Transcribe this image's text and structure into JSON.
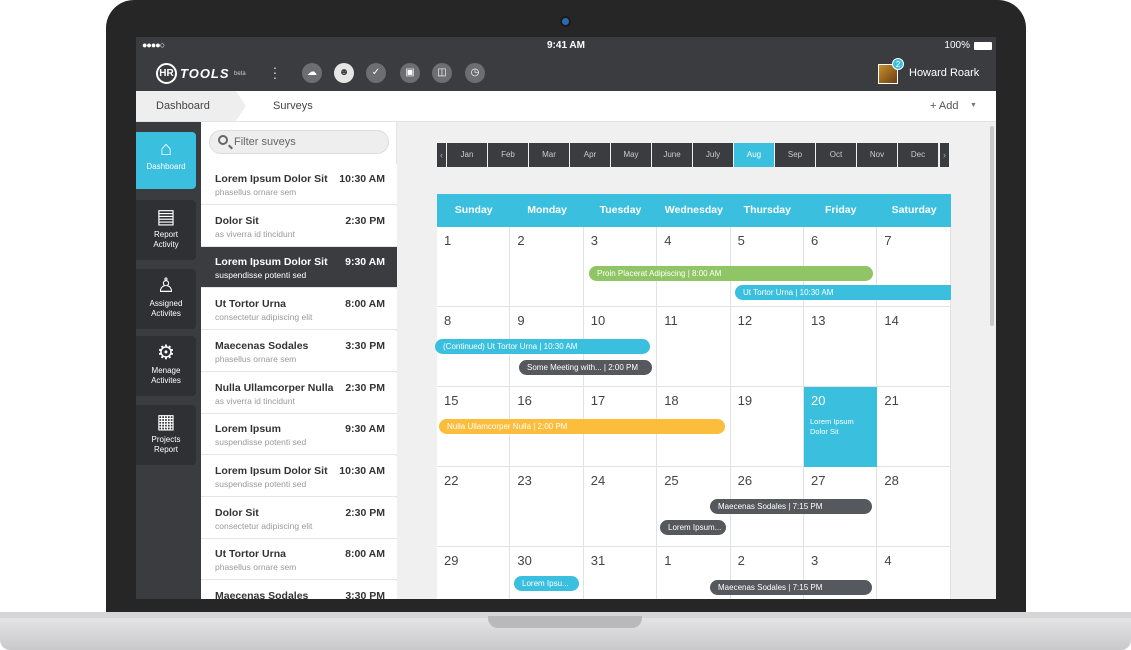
{
  "statusbar": {
    "signal": "●●●●○",
    "time": "9:41 AM",
    "battery": "100%"
  },
  "topbar": {
    "logo_text": "TOOLS",
    "logo_mark": "HR",
    "logo_suffix": "beta",
    "icons": [
      "chat-icon",
      "people-icon",
      "clipboard-icon",
      "book-icon",
      "briefcase-icon",
      "watch-icon"
    ],
    "user": {
      "name": "Howard Roark",
      "notifications": "2"
    }
  },
  "breadcrumb": {
    "first": "Dashboard",
    "second": "Surveys",
    "add_label": "+ Add"
  },
  "sidebar": {
    "items": [
      {
        "label": "Dashboard",
        "icon": "⌂"
      },
      {
        "label": "Report Activity",
        "icon": "▤"
      },
      {
        "label": "Assigned Activites",
        "icon": "♙"
      },
      {
        "label": "Menage Activites",
        "icon": "⚙"
      },
      {
        "label": "Projects Report",
        "icon": "▦"
      }
    ]
  },
  "survey_list": {
    "filter_placeholder": "Filter suveys",
    "items": [
      {
        "title": "Lorem Ipsum Dolor Sit",
        "time": "10:30 AM",
        "subtitle": "phasellus ornare sem"
      },
      {
        "title": "Dolor Sit",
        "time": "2:30 PM",
        "subtitle": "as viverra id tincidunt"
      },
      {
        "title": "Lorem Ipsum Dolor Sit",
        "time": "9:30 AM",
        "subtitle": "suspendisse potenti sed"
      },
      {
        "title": "Ut Tortor Urna",
        "time": "8:00 AM",
        "subtitle": "consectetur adipiscing elit"
      },
      {
        "title": "Maecenas Sodales",
        "time": "3:30 PM",
        "subtitle": "phasellus ornare sem"
      },
      {
        "title": "Nulla Ullamcorper Nulla",
        "time": "2:30 PM",
        "subtitle": "as viverra id tincidunt"
      },
      {
        "title": "Lorem Ipsum",
        "time": "9:30 AM",
        "subtitle": "suspendisse potenti sed"
      },
      {
        "title": "Lorem Ipsum Dolor Sit",
        "time": "10:30 AM",
        "subtitle": "suspendisse potenti sed"
      },
      {
        "title": "Dolor Sit",
        "time": "2:30 PM",
        "subtitle": "consectetur adipiscing elit"
      },
      {
        "title": "Ut Tortor Urna",
        "time": "8:00 AM",
        "subtitle": "phasellus ornare sem"
      },
      {
        "title": "Maecenas Sodales",
        "time": "3:30 PM",
        "subtitle": ""
      }
    ]
  },
  "calendar": {
    "months": [
      "Jan",
      "Feb",
      "Mar",
      "Apr",
      "May",
      "June",
      "July",
      "Aug",
      "Sep",
      "Oct",
      "Nov",
      "Dec"
    ],
    "active_month": "Aug",
    "weekdays": [
      "Sunday",
      "Monday",
      "Tuesday",
      "Wednesday",
      "Thursday",
      "Friday",
      "Saturday"
    ],
    "weeks": [
      [
        "1",
        "2",
        "3",
        "4",
        "5",
        "6",
        "7"
      ],
      [
        "8",
        "9",
        "10",
        "11",
        "12",
        "13",
        "14"
      ],
      [
        "15",
        "16",
        "17",
        "18",
        "19",
        "20",
        "21"
      ],
      [
        "22",
        "23",
        "24",
        "25",
        "26",
        "27",
        "28"
      ],
      [
        "29",
        "30",
        "31",
        "1",
        "2",
        "3",
        "4"
      ]
    ],
    "highlight_note": "Lorem Ipsum Dolor Sit",
    "events": [
      {
        "label": "Proin Placerat Adipiscing  |  8:00 AM",
        "color": "#8fc565"
      },
      {
        "label": "Ut Tortor Urna  | 10:30 AM",
        "color": "#3bbfdf"
      },
      {
        "label": "(Continued) Ut Tortor Urna  |  10:30 AM",
        "color": "#3bbfdf"
      },
      {
        "label": "Some Meeting with...  | 2:00 PM",
        "color": "#55585c"
      },
      {
        "label": "Nulla Ullamcorper Nulla  | 2:00 PM",
        "color": "#fbbd3b"
      },
      {
        "label": "Maecenas Sodales  | 7:15 PM",
        "color": "#55585c"
      },
      {
        "label": "Lorem Ipsum...",
        "color": "#55585c"
      },
      {
        "label": "Lorem Ipsu...",
        "color": "#3bbfdf"
      },
      {
        "label": "Maecenas Sodales  | 7:15 PM",
        "color": "#55585c"
      }
    ]
  },
  "colors": {
    "accent": "#3bbfdf",
    "dark": "#3a3c3f",
    "green": "#8fc565",
    "orange": "#fbbd3b"
  }
}
